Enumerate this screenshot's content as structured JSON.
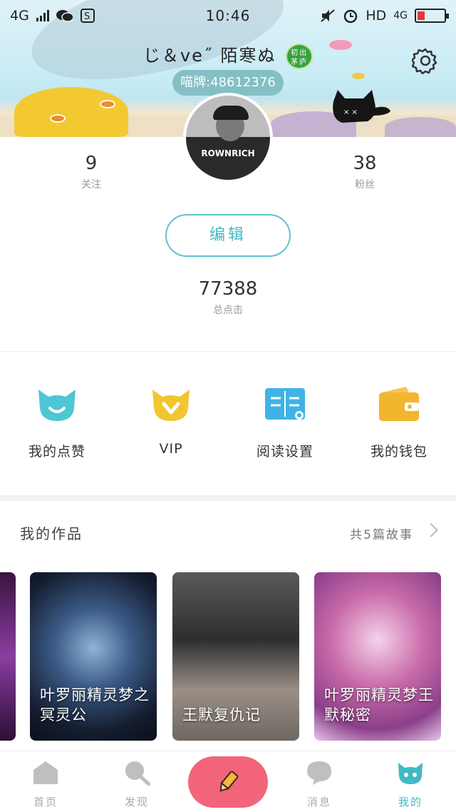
{
  "status_bar": {
    "network": "4G",
    "time": "10:46",
    "hd": "HD",
    "network_right": "4G"
  },
  "profile": {
    "name": "じ＆ve˝ 陌寒ぬ",
    "badge": "初出茅庐",
    "uid": "喵牌:48612376",
    "avatar_text": "ROWNRICH"
  },
  "stats": {
    "following_count": "9",
    "following_label": "关注",
    "followers_count": "38",
    "followers_label": "粉丝",
    "clicks_count": "77388",
    "clicks_label": "总点击"
  },
  "edit_label": "编辑",
  "menu": [
    {
      "label": "我的点赞",
      "icon": "cat-face-icon",
      "color": "#4ec6d3"
    },
    {
      "label": "VIP",
      "icon": "vip-cat-icon",
      "color": "#f2c630"
    },
    {
      "label": "阅读设置",
      "icon": "book-icon",
      "color": "#3fb3e6"
    },
    {
      "label": "我的钱包",
      "icon": "wallet-icon",
      "color": "#f2b52e"
    }
  ],
  "works": {
    "title": "我的作品",
    "count_text": "共5篇故事",
    "items": [
      {
        "title": "叶罗丽精灵梦之冥灵公"
      },
      {
        "title": "王默复仇记"
      },
      {
        "title": "叶罗丽精灵梦王默秘密"
      }
    ]
  },
  "tabs": [
    {
      "label": "首页",
      "icon": "home-icon"
    },
    {
      "label": "发现",
      "icon": "search-icon"
    },
    {
      "label": "消息",
      "icon": "message-icon"
    },
    {
      "label": "我的",
      "icon": "cat-profile-icon"
    }
  ],
  "colors": {
    "accent": "#41b9c6",
    "create_button": "#f2647a"
  }
}
